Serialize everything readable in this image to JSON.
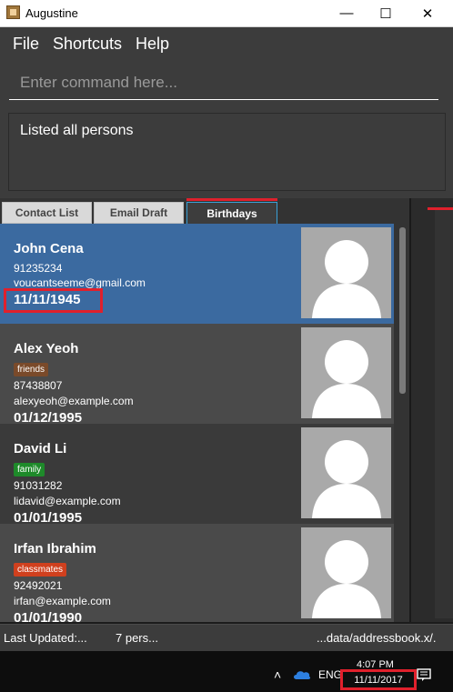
{
  "window": {
    "title": "Augustine"
  },
  "menu": [
    "File",
    "Shortcuts",
    "Help"
  ],
  "command": {
    "placeholder": "Enter command here..."
  },
  "result": {
    "text": "Listed all persons"
  },
  "tabs": [
    {
      "label": "Contact List",
      "active": false
    },
    {
      "label": "Email Draft",
      "active": false
    },
    {
      "label": "Birthdays",
      "active": true
    }
  ],
  "persons": [
    {
      "name": "John Cena",
      "tag": "",
      "tag_color": "",
      "phone": "91235234",
      "email": "voucantseeme@gmail.com",
      "birthday": "11/11/1945",
      "selected": true
    },
    {
      "name": "Alex Yeoh",
      "tag": "friends",
      "tag_color": "#7a4a2a",
      "phone": "87438807",
      "email": "alexyeoh@example.com",
      "birthday": "01/12/1995",
      "selected": false
    },
    {
      "name": "David Li",
      "tag": "family",
      "tag_color": "#1e8a2a",
      "phone": "91031282",
      "email": "lidavid@example.com",
      "birthday": "01/01/1995",
      "selected": false
    },
    {
      "name": "Irfan Ibrahim",
      "tag": "classmates",
      "tag_color": "#d0401e",
      "phone": "92492021",
      "email": "irfan@example.com",
      "birthday": "01/01/1990",
      "selected": false
    }
  ],
  "status": {
    "last_updated": "Last Updated:...",
    "count": "7 pers...",
    "path": "...data/addressbook.x/."
  },
  "taskbar": {
    "lang": "ENG",
    "time": "4:07 PM",
    "date": "11/11/2017"
  },
  "colors": {
    "selected_card": "#3b6aa0",
    "card_dark": "#3a3a3a",
    "card_mid": "#4a4a4a",
    "highlight_red": "#e0202c"
  }
}
